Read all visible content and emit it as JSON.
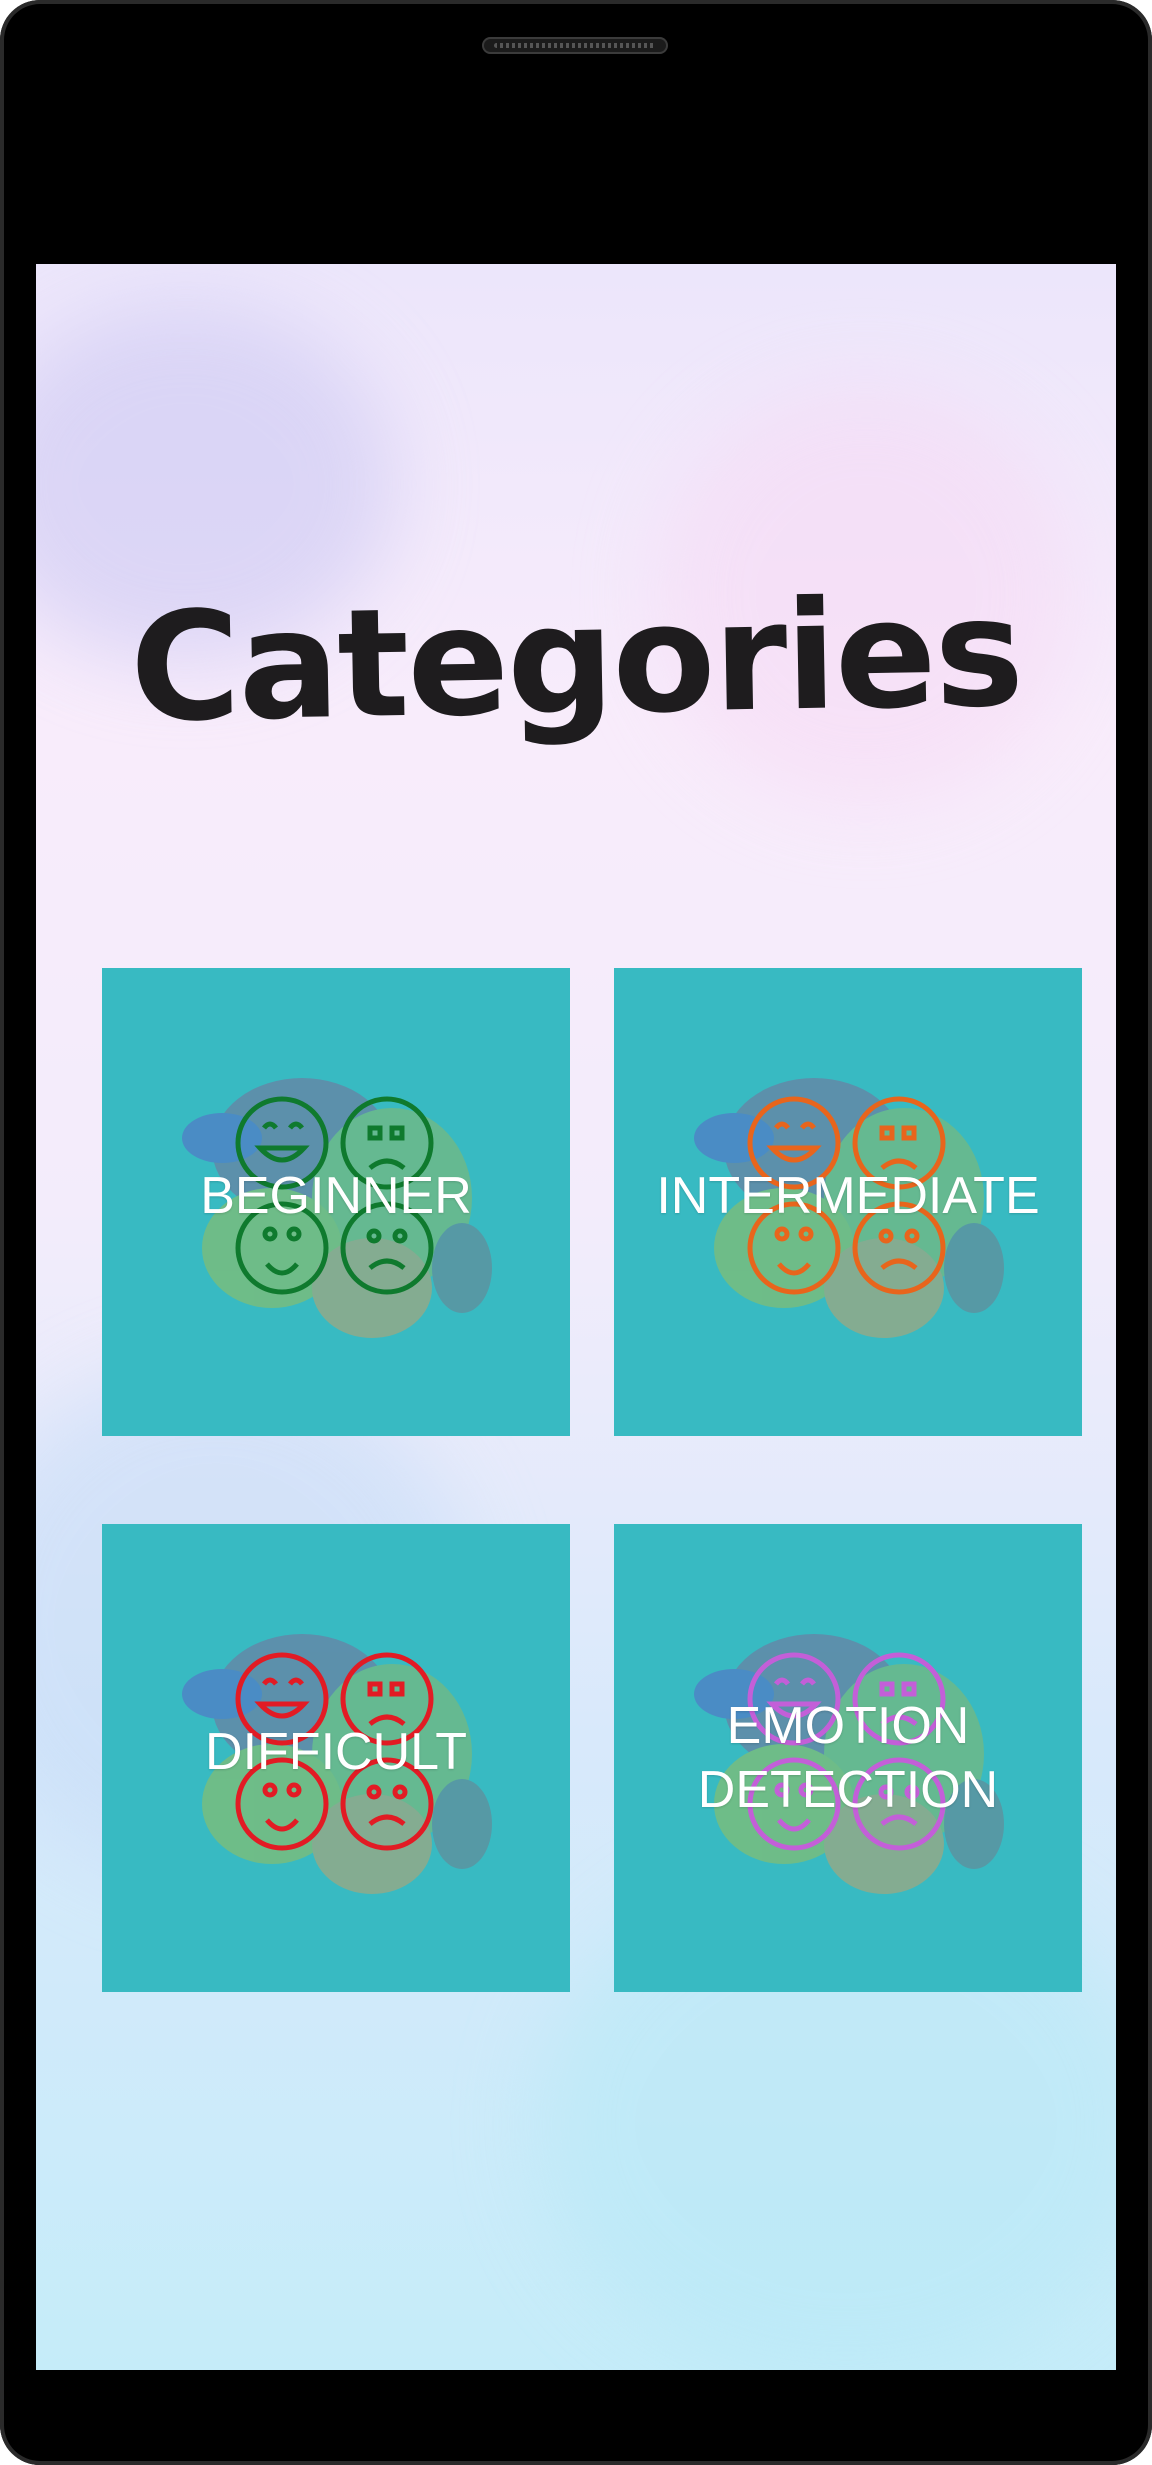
{
  "title": "Categories",
  "categories": [
    {
      "label": "BEGINNER",
      "icon": "emotion-faces-icon",
      "face_color": "#0f7a2e"
    },
    {
      "label": "INTERMEDIATE",
      "icon": "emotion-faces-icon",
      "face_color": "#e8651c"
    },
    {
      "label": "DIFFICULT",
      "icon": "emotion-faces-icon",
      "face_color": "#e21b24"
    },
    {
      "label_line1": "EMOTION",
      "label_line2": "DETECTION",
      "icon": "emotion-faces-icon",
      "face_color": "#c35fd8"
    }
  ],
  "colors": {
    "tile_bg": "#38bac2",
    "title": "#1e1c1e"
  }
}
